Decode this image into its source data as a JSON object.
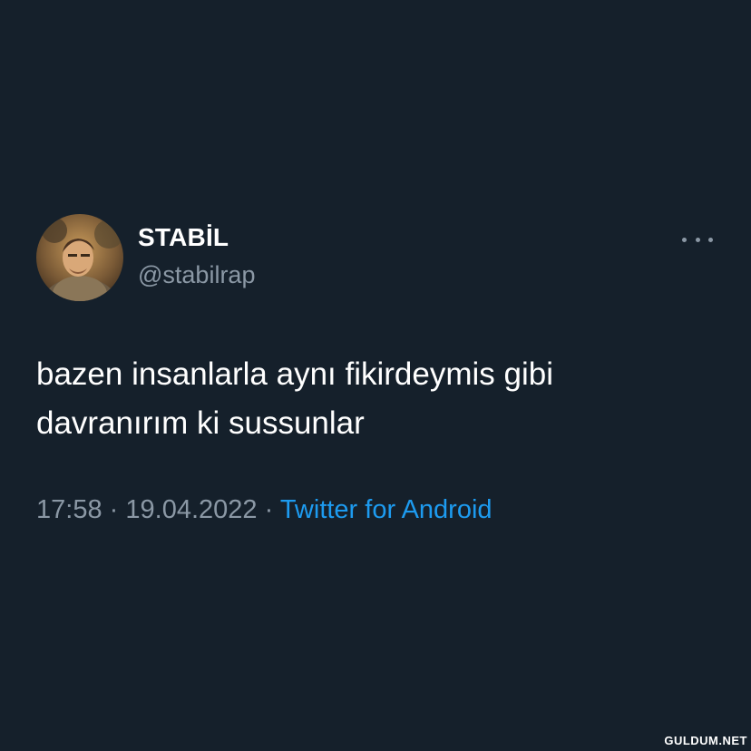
{
  "tweet": {
    "display_name": "STABİL",
    "handle": "@stabilrap",
    "text_lines": [
      "bazen insanlarla aynı fikirdeymis gibi",
      "davranırım ki sussunlar"
    ],
    "time": "17:58",
    "separator": "·",
    "date": "19.04.2022",
    "source": "Twitter for Android",
    "more_icon": "more-horizontal-icon",
    "avatar_icon": "profile-avatar"
  },
  "watermark": "GULDUM.NET",
  "colors": {
    "background": "#15202b",
    "primary_text": "#ffffff",
    "secondary_text": "#8b98a5",
    "accent": "#1d9bf0"
  }
}
